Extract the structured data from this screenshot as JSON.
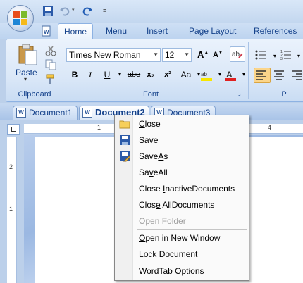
{
  "qat": {
    "icons": [
      "save-icon",
      "undo-icon",
      "redo-icon",
      "customize-icon"
    ]
  },
  "ribbon_tabs": [
    "Home",
    "Menu",
    "Insert",
    "Page Layout",
    "References"
  ],
  "clipboard": {
    "paste_label": "Paste",
    "group_label": "Clipboard"
  },
  "font": {
    "family": "Times New Roman",
    "size": "12",
    "group_label": "Font",
    "buttons": [
      "B",
      "I",
      "U",
      "abe",
      "x₂",
      "x²",
      "Aa"
    ]
  },
  "doc_tabs": [
    "Document1",
    "Document2",
    "Document3"
  ],
  "ruler_marks": [
    "1",
    "4",
    "2",
    "1"
  ],
  "context_menu": {
    "items": [
      {
        "label": "Close",
        "underline": "C",
        "icon": "folder-icon"
      },
      {
        "label": "Save",
        "underline": "S",
        "icon": "save-icon"
      },
      {
        "label": "SaveAs",
        "underline": "A",
        "icon": "save-as-icon"
      },
      {
        "label": "SaveAll",
        "underline": "v"
      },
      {
        "label": "Close InactiveDocuments",
        "underline": "I"
      },
      {
        "label": "Close AllDocuments",
        "underline": "e"
      },
      {
        "label": "Open Folder",
        "underline": "d",
        "disabled": true
      },
      {
        "label": "Open in New Window",
        "underline": "O"
      },
      {
        "label": "Lock Document",
        "underline": "L"
      },
      {
        "label": "WordTab Options",
        "underline": "W"
      }
    ]
  }
}
